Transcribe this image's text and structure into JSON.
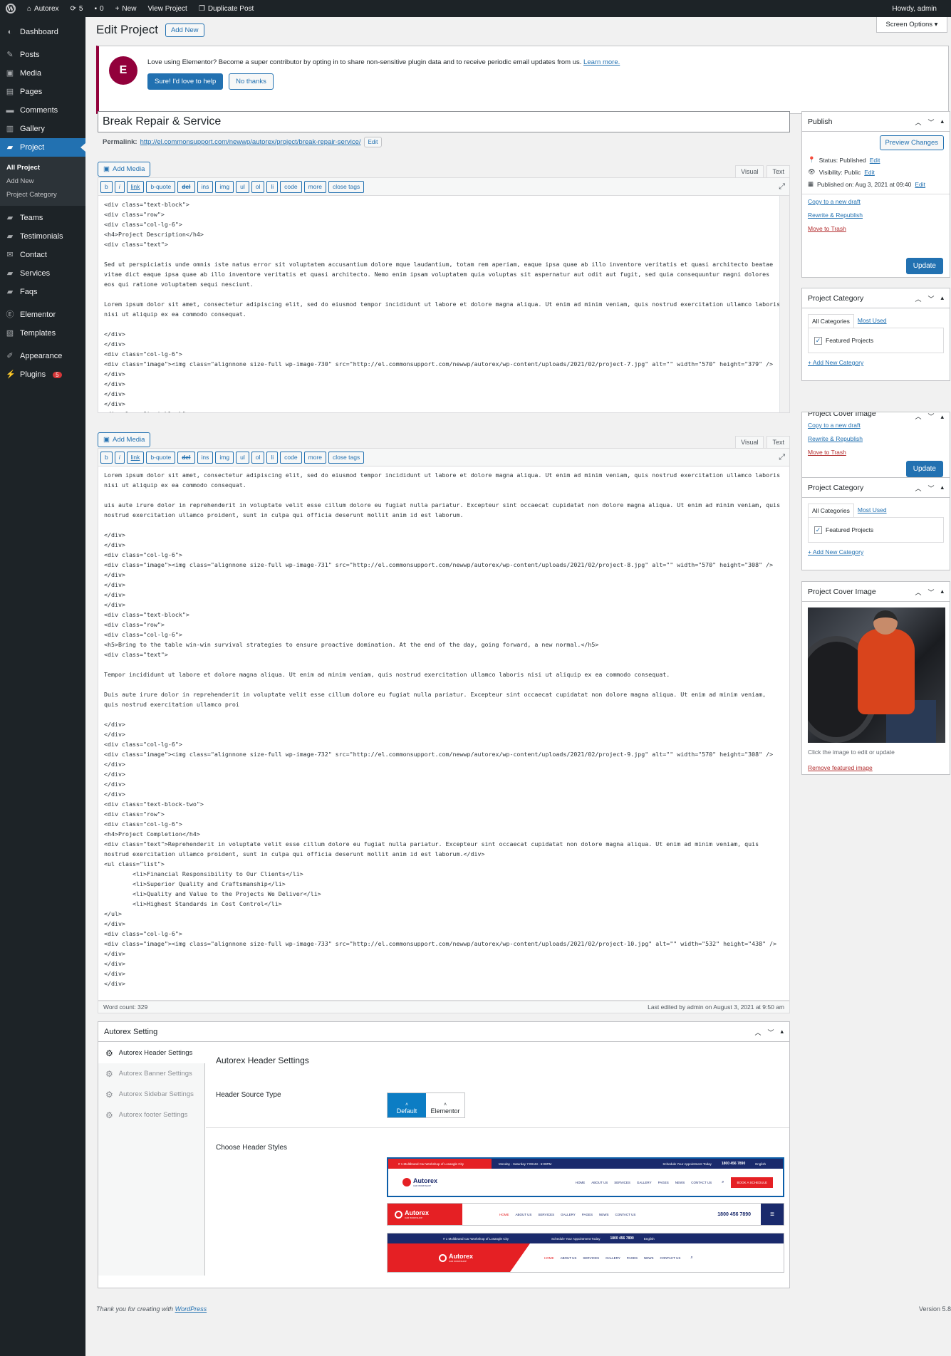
{
  "adminbar": {
    "site": "Autorex",
    "updates": "5",
    "comments": "0",
    "new": "New",
    "view": "View Project",
    "duplicate": "Duplicate Post",
    "howdy": "Howdy, admin"
  },
  "sidebar": {
    "items": [
      "Dashboard",
      "Posts",
      "Media",
      "Pages",
      "Comments",
      "Gallery",
      "Project",
      "Teams",
      "Testimonials",
      "Contact",
      "Services",
      "Faqs",
      "Elementor",
      "Templates",
      "Appearance",
      "Plugins"
    ],
    "plugins_badge": "5",
    "submenu": [
      "All Project",
      "Add New",
      "Project Category"
    ]
  },
  "page": {
    "title": "Edit Project",
    "add_new": "Add New",
    "screen_options": "Screen Options"
  },
  "notice": {
    "text": "Love using Elementor? Become a super contributor by opting in to share non-sensitive plugin data and to receive periodic email updates from us.",
    "learn_more": "Learn more.",
    "accept": "Sure! I'd love to help",
    "decline": "No thanks"
  },
  "post": {
    "title": "Break Repair & Service",
    "permalink_label": "Permalink:",
    "permalink": "http://el.commonsupport.com/newwp/autorex/project/break-repair-service/",
    "edit": "Edit"
  },
  "editor": {
    "add_media": "Add Media",
    "visual": "Visual",
    "text": "Text",
    "quicktags": [
      "b",
      "i",
      "link",
      "b-quote",
      "del",
      "ins",
      "img",
      "ul",
      "ol",
      "li",
      "code",
      "more",
      "close tags"
    ],
    "code1": "<div class=\"text-block\">\n<div class=\"row\">\n<div class=\"col-lg-6\">\n<h4>Project Description</h4>\n<div class=\"text\">\n\nSed ut perspiciatis unde omnis iste natus error sit voluptatem accusantium dolore mque laudantium, totam rem aperiam, eaque ipsa quae ab illo inventore veritatis et quasi architecto beatae vitae dict eaque ipsa quae ab illo inventore veritatis et quasi architecto. Nemo enim ipsam voluptatem quia voluptas sit aspernatur aut odit aut fugit, sed quia consequuntur magni dolores eos qui ratione voluptatem sequi nesciunt.\n\nLorem ipsum dolor sit amet, consectetur adipiscing elit, sed do eiusmod tempor incididunt ut labore et dolore magna aliqua. Ut enim ad minim veniam, quis nostrud exercitation ullamco laboris nisi ut aliquip ex ea commodo consequat.\n\n</div>\n</div>\n<div class=\"col-lg-6\">\n<div class=\"image\"><img class=\"alignnone size-full wp-image-730\" src=\"http://el.commonsupport.com/newwp/autorex/wp-content/uploads/2021/02/project-7.jpg\" alt=\"\" width=\"570\" height=\"379\" /></div>\n</div>\n</div>\n</div>\n<div class=\"text-block\">",
    "code2": "Lorem ipsum dolor sit amet, consectetur adipiscing elit, sed do eiusmod tempor incididunt ut labore et dolore magna aliqua. Ut enim ad minim veniam, quis nostrud exercitation ullamco laboris nisi ut aliquip ex ea commodo consequat.\n\nuis aute irure dolor in reprehenderit in voluptate velit esse cillum dolore eu fugiat nulla pariatur. Excepteur sint occaecat cupidatat non dolore magna aliqua. Ut enim ad minim veniam, quis nostrud exercitation ullamco proident, sunt in culpa qui officia deserunt mollit anim id est laborum.\n\n</div>\n</div>\n<div class=\"col-lg-6\">\n<div class=\"image\"><img class=\"alignnone size-full wp-image-731\" src=\"http://el.commonsupport.com/newwp/autorex/wp-content/uploads/2021/02/project-8.jpg\" alt=\"\" width=\"570\" height=\"308\" /></div>\n</div>\n</div>\n</div>\n<div class=\"text-block\">\n<div class=\"row\">\n<div class=\"col-lg-6\">\n<h5>Bring to the table win-win survival strategies to ensure proactive domination. At the end of the day, going forward, a new normal.</h5>\n<div class=\"text\">\n\nTempor incididunt ut labore et dolore magna aliqua. Ut enim ad minim veniam, quis nostrud exercitation ullamco laboris nisi ut aliquip ex ea commodo consequat.\n\nDuis aute irure dolor in reprehenderit in voluptate velit esse cillum dolore eu fugiat nulla pariatur. Excepteur sint occaecat cupidatat non dolore magna aliqua. Ut enim ad minim veniam, quis nostrud exercitation ullamco proi\n\n</div>\n</div>\n<div class=\"col-lg-6\">\n<div class=\"image\"><img class=\"alignnone size-full wp-image-732\" src=\"http://el.commonsupport.com/newwp/autorex/wp-content/uploads/2021/02/project-9.jpg\" alt=\"\" width=\"570\" height=\"308\" /></div>\n</div>\n</div>\n</div>\n<div class=\"text-block-two\">\n<div class=\"row\">\n<div class=\"col-lg-6\">\n<h4>Project Completion</h4>\n<div class=\"text\">Reprehenderit in voluptate velit esse cillum dolore eu fugiat nulla pariatur. Excepteur sint occaecat cupidatat non dolore magna aliqua. Ut enim ad minim veniam, quis nostrud exercitation ullamco proident, sunt in culpa qui officia deserunt mollit anim id est laborum.</div>\n<ul class=\"list\">\n        <li>Financial Responsibility to Our Clients</li>\n        <li>Superior Quality and Craftsmanship</li>\n        <li>Quality and Value to the Projects We Deliver</li>\n        <li>Highest Standards in Cost Control</li>\n</ul>\n</div>\n<div class=\"col-lg-6\">\n<div class=\"image\"><img class=\"alignnone size-full wp-image-733\" src=\"http://el.commonsupport.com/newwp/autorex/wp-content/uploads/2021/02/project-10.jpg\" alt=\"\" width=\"532\" height=\"438\" /></div>\n</div>\n</div>\n</div>",
    "word_count": "Word count: 329",
    "last_edited": "Last edited by admin on August 3, 2021 at 9:50 am"
  },
  "publish": {
    "title": "Publish",
    "preview": "Preview Changes",
    "status": "Status: Published",
    "visibility": "Visibility: Public",
    "published_on": "Published on: Aug 3, 2021 at 09:40",
    "edit": "Edit",
    "copy": "Copy to a new draft",
    "rewrite": "Rewrite & Republish",
    "trash": "Move to Trash",
    "update": "Update"
  },
  "category": {
    "title": "Project Category",
    "all": "All Categories",
    "most_used": "Most Used",
    "item": "Featured Projects",
    "add": "+ Add New Category"
  },
  "dragging_box": {
    "title": "Project Cover Image"
  },
  "cover": {
    "title": "Project Cover Image",
    "hint": "Click the image to edit or update",
    "remove": "Remove featured image"
  },
  "autorex": {
    "title": "Autorex Setting",
    "tabs": [
      "Autorex Header Settings",
      "Autorex Banner Settings",
      "Autorex Sidebar Settings",
      "Autorex footer Settings"
    ],
    "heading": "Autorex Header Settings",
    "source_label": "Header Source Type",
    "source_default": "Default",
    "source_elementor": "Elementor",
    "styles_label": "Choose Header Styles",
    "header1": {
      "topline": "# 1 Multibrand Car Workshop of Losangle City",
      "hours": "Monday - Saturday 7:00AM - 6:00PM",
      "schedule": "Schedule Your Appointment Today",
      "phone": "1800 456 7890",
      "lang": "English",
      "logo": "Autorex",
      "sub": "CAR WORKSHOP",
      "nav": [
        "HOME",
        "ABOUT US",
        "SERVICES",
        "GALLERY",
        "PAGES",
        "NEWS",
        "CONTACT US"
      ],
      "cta": "BOOK A SCHEDULE"
    },
    "header2": {
      "logo": "Autorex",
      "sub": "CAR WORKSHOP",
      "nav": [
        "HOME",
        "ABOUT US",
        "SERVICES",
        "GALLERY",
        "PAGES",
        "NEWS",
        "CONTACT US"
      ],
      "phone": "1800 456 7890"
    },
    "header3": {
      "topline": "# 1 Multibrand Car Workshop of Losangle City",
      "schedule": "Schedule Your Appointment Today",
      "phone": "1800 456 7890",
      "lang": "English",
      "logo": "Autorex",
      "sub": "CAR WORKSHOP",
      "nav": [
        "HOME",
        "ABOUT US",
        "SERVICES",
        "GALLERY",
        "PAGES",
        "NEWS",
        "CONTACT US"
      ]
    }
  },
  "footer": {
    "thanks": "Thank you for creating with",
    "wp": "WordPress",
    "version": "Version 5.8"
  },
  "colors": {
    "accent": "#2271b1",
    "elementor": "#92003b",
    "autorex_red": "#e52024",
    "autorex_navy": "#1a2a6c"
  }
}
